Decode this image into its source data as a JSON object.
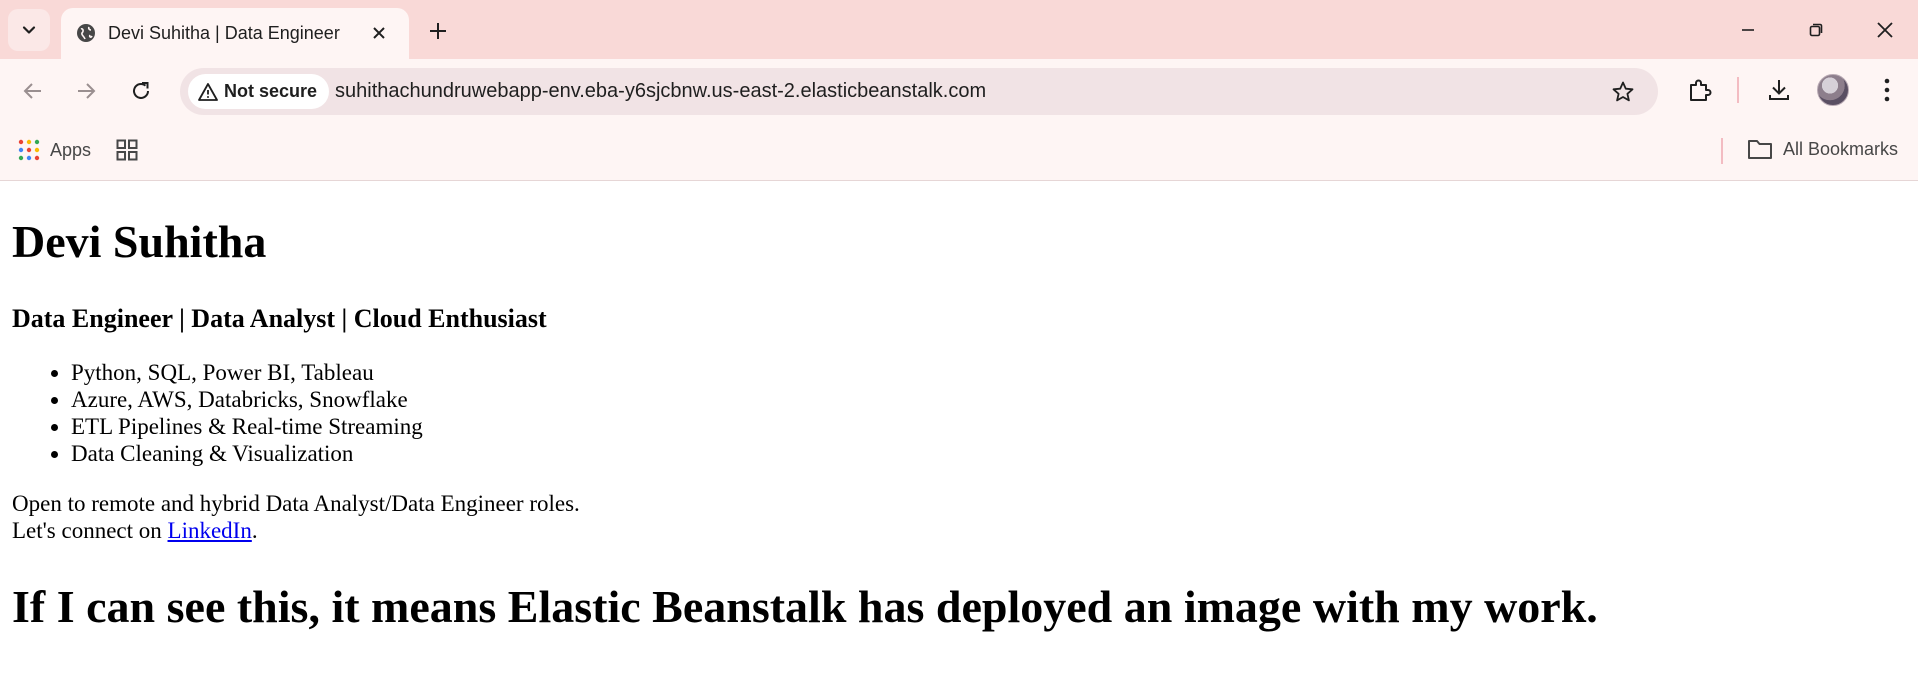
{
  "browser": {
    "tab_title": "Devi Suhitha | Data Engineer",
    "security_label": "Not secure",
    "url": "suhithachundruwebapp-env.eba-y6sjcbnw.us-east-2.elasticbeanstalk.com",
    "bookmarks": {
      "apps_label": "Apps",
      "all_bookmarks_label": "All Bookmarks"
    },
    "icons": [
      "tab-search-icon",
      "globe-icon",
      "close-icon",
      "plus-icon",
      "minimize-icon",
      "restore-icon",
      "close-window-icon",
      "back-icon",
      "forward-icon",
      "reload-icon",
      "warning-icon",
      "star-icon",
      "extensions-icon",
      "download-icon",
      "avatar",
      "more-vert-icon",
      "apps-grid-icon",
      "tab-groups-icon",
      "folder-icon"
    ]
  },
  "page": {
    "name": "Devi Suhitha",
    "role": "Data Engineer | Data Analyst | Cloud Enthusiast",
    "skills": [
      "Python, SQL, Power BI, Tableau",
      "Azure, AWS, Databricks, Snowflake",
      "ETL Pipelines & Real-time Streaming",
      "Data Cleaning & Visualization"
    ],
    "availability": "Open to remote and hybrid Data Analyst/Data Engineer roles.",
    "connect_prefix": "Let's connect on ",
    "linkedin_label": "LinkedIn",
    "connect_suffix": ".",
    "deploy_message": "If I can see this, it means Elastic Beanstalk has deployed an image with my work."
  }
}
